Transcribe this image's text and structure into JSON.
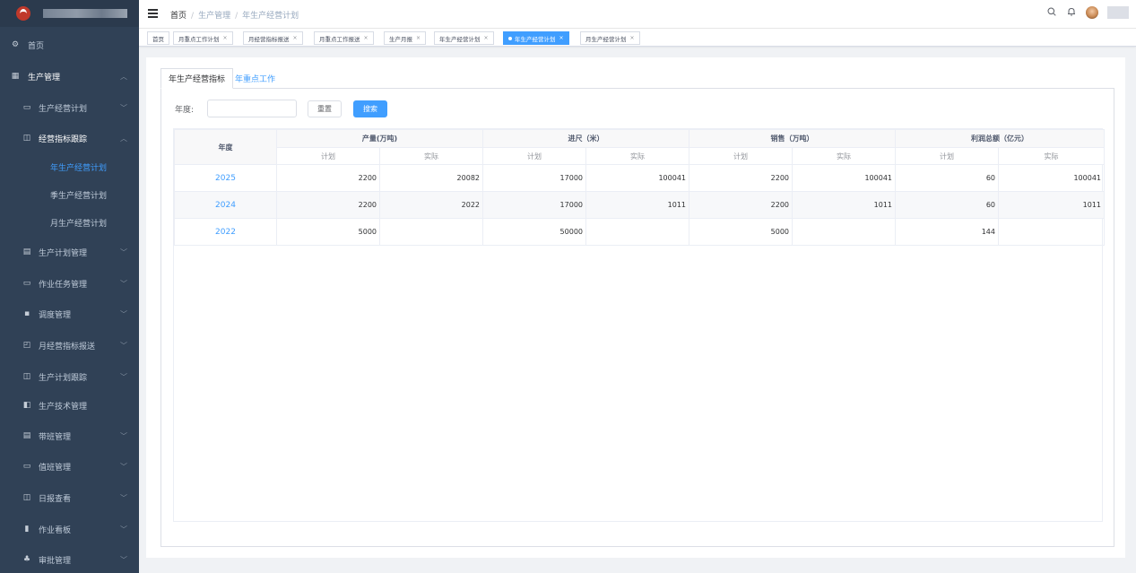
{
  "colors": {
    "sidebar_bg": "#304156",
    "accent": "#409eff",
    "header_bg": "#ffffff",
    "page_bg": "#f0f2f5"
  },
  "sidebar": {
    "items": [
      {
        "label": "首页",
        "icon": "dashboard-icon",
        "glyph": "⚙"
      },
      {
        "label": "生产管理",
        "icon": "grid-icon",
        "glyph": "▦"
      },
      {
        "label": "生产经营计划",
        "icon": "monitor-icon",
        "glyph": "▭"
      },
      {
        "label": "经营指标跟踪",
        "icon": "book-icon",
        "glyph": "◫"
      },
      {
        "label": "年生产经营计划"
      },
      {
        "label": "季生产经营计划"
      },
      {
        "label": "月生产经营计划"
      },
      {
        "label": "生产计划管理",
        "icon": "table-icon",
        "glyph": "▤"
      },
      {
        "label": "作业任务管理",
        "icon": "monitor-icon",
        "glyph": "▭"
      },
      {
        "label": "调度管理",
        "icon": "clipboard-icon",
        "glyph": "▪"
      },
      {
        "label": "月经营指标报送",
        "icon": "report-icon",
        "glyph": "◰"
      },
      {
        "label": "生产计划跟踪",
        "icon": "book-icon",
        "glyph": "◫"
      },
      {
        "label": "生产技术管理",
        "icon": "document-icon",
        "glyph": "◧"
      },
      {
        "label": "带班管理",
        "icon": "list-icon",
        "glyph": "▤"
      },
      {
        "label": "值班管理",
        "icon": "monitor-icon",
        "glyph": "▭"
      },
      {
        "label": "日报查看",
        "icon": "book-icon",
        "glyph": "◫"
      },
      {
        "label": "作业看板",
        "icon": "bar-chart-icon",
        "glyph": "▮"
      },
      {
        "label": "审批管理",
        "icon": "tree-icon",
        "glyph": "♣"
      }
    ]
  },
  "breadcrumb": {
    "home": "首页",
    "sep": "/",
    "level1": "生产管理",
    "level2": "年生产经营计划"
  },
  "tags": [
    {
      "label": "首页"
    },
    {
      "label": "月重点工作计划",
      "close": "×"
    },
    {
      "label": "月经营指标报送",
      "close": "×"
    },
    {
      "label": "月重点工作报送",
      "close": "×"
    },
    {
      "label": "生产月报",
      "close": "×"
    },
    {
      "label": "年生产经营计划",
      "close": "×"
    },
    {
      "label": "年生产经营计划",
      "close": "×"
    },
    {
      "label": "月生产经营计划",
      "close": "×"
    }
  ],
  "tabs": [
    {
      "label": "年生产经营指标"
    },
    {
      "label": "年重点工作"
    }
  ],
  "search": {
    "label": "年度:",
    "value": "",
    "placeholder": "",
    "reset_label": "重置",
    "search_label": "搜索"
  },
  "table": {
    "year_header": "年度",
    "groups": [
      "产量(万吨)",
      "进尺（米）",
      "销售（万吨）",
      "利润总额（亿元）"
    ],
    "sub_plan": "计划",
    "sub_actual": "实际",
    "rows": [
      {
        "year": "2025",
        "cells": [
          "2200",
          "20082",
          "17000",
          "100041",
          "2200",
          "100041",
          "60",
          "100041"
        ]
      },
      {
        "year": "2024",
        "cells": [
          "2200",
          "2022",
          "17000",
          "1011",
          "2200",
          "1011",
          "60",
          "1011"
        ]
      },
      {
        "year": "2022",
        "cells": [
          "5000",
          "",
          "50000",
          "",
          "5000",
          "",
          "144",
          ""
        ]
      }
    ]
  }
}
